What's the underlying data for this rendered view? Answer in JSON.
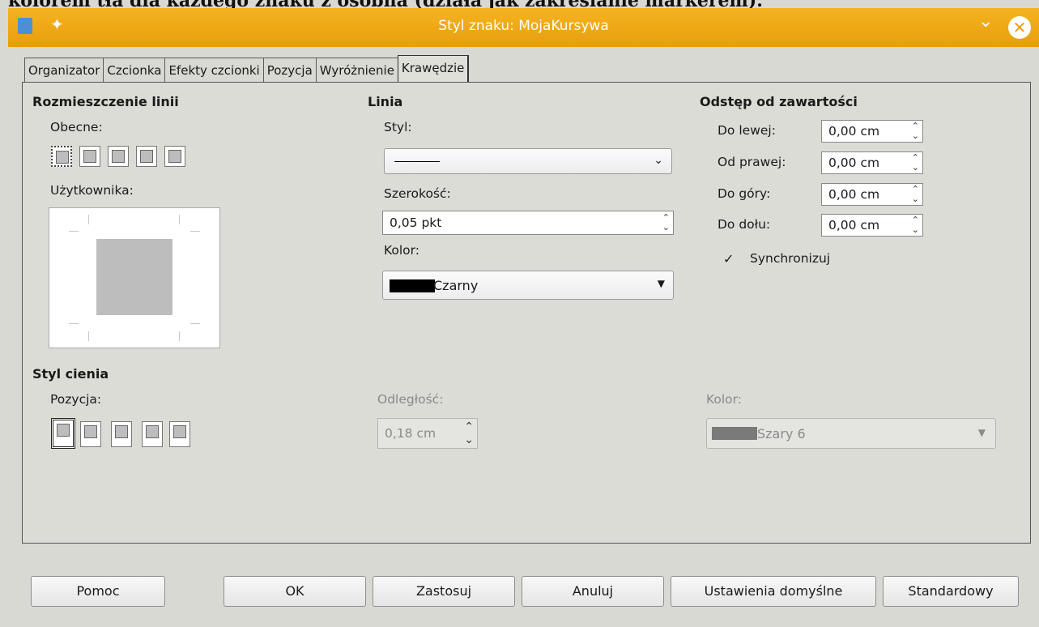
{
  "background_text": "kolorem tła dla każdego znaku z osobna (działa jak zakreślanie markerem).",
  "titlebar": {
    "title": "Styl znaku: MojaKursywa",
    "accent": "#eba313"
  },
  "tabs": [
    "Organizator",
    "Czcionka",
    "Efekty czcionki",
    "Pozycja",
    "Wyróżnienie",
    "Krawędzie"
  ],
  "line_arrangement": {
    "heading": "Rozmieszczenie linii",
    "presets_label": "Obecne:",
    "user_label": "Użytkownika:"
  },
  "line": {
    "heading": "Linia",
    "style_label": "Styl:",
    "width_label": "Szerokość:",
    "width_value": "0,05 pkt",
    "color_label": "Kolor:",
    "color_value": "Czarny",
    "color_swatch": "#000000"
  },
  "padding": {
    "heading": "Odstęp od zawartości",
    "left_label": "Do lewej:",
    "left_value": "0,00 cm",
    "right_label": "Od prawej:",
    "right_value": "0,00 cm",
    "top_label": "Do góry:",
    "top_value": "0,00 cm",
    "bottom_label": "Do dołu:",
    "bottom_value": "0,00 cm",
    "sync_label": "Synchronizuj",
    "sync_checked": true
  },
  "shadow": {
    "heading": "Styl cienia",
    "position_label": "Pozycja:",
    "distance_label": "Odległość:",
    "distance_value": "0,18 cm",
    "color_label": "Kolor:",
    "color_value": "Szary 6",
    "color_swatch": "#7a7a7a"
  },
  "buttons": {
    "help": "Pomoc",
    "ok": "OK",
    "apply": "Zastosuj",
    "cancel": "Anuluj",
    "defaults": "Ustawienia domyślne",
    "standard": "Standardowy"
  }
}
